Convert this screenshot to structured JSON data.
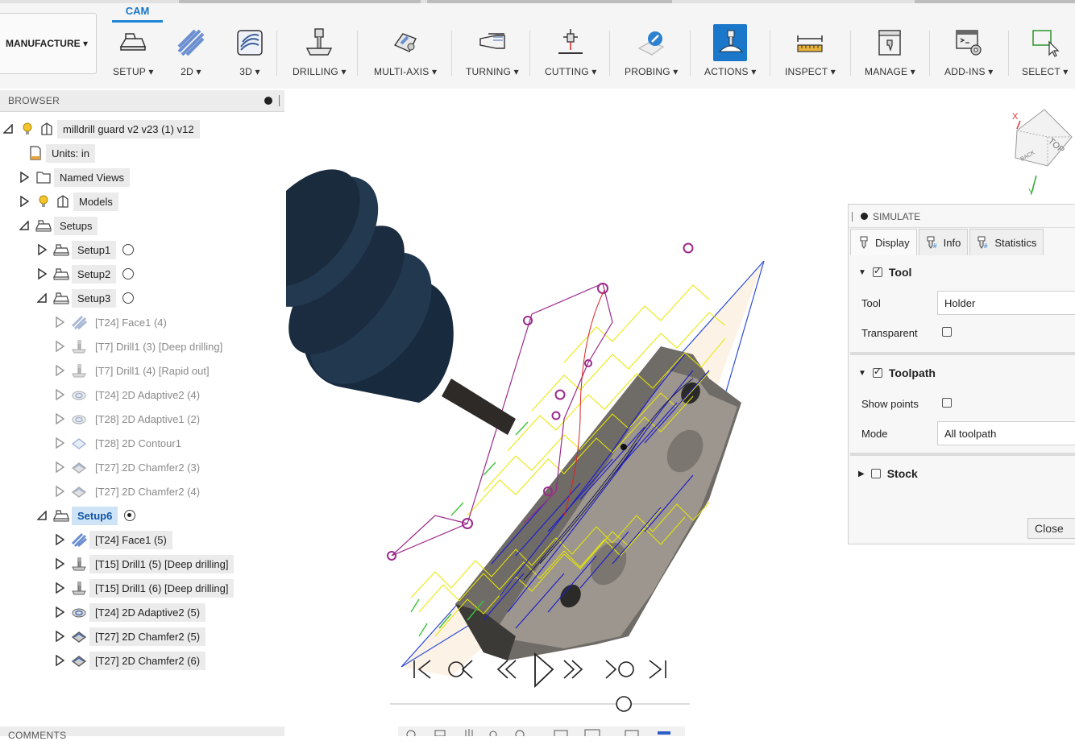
{
  "workspace": {
    "label": "MANUFACTURE ▾"
  },
  "cam_tab": {
    "label": "CAM"
  },
  "toolbar": {
    "groups": [
      {
        "label": "SETUP ▾",
        "icon": "setup-icon"
      },
      {
        "label": "2D ▾",
        "icon": "2d-milling-icon"
      },
      {
        "label": "3D ▾",
        "icon": "3d-milling-icon"
      },
      {
        "label": "DRILLING ▾",
        "icon": "drilling-icon"
      },
      {
        "label": "MULTI-AXIS ▾",
        "icon": "multi-axis-icon"
      },
      {
        "label": "TURNING ▾",
        "icon": "turning-icon"
      },
      {
        "label": "CUTTING ▾",
        "icon": "cutting-icon"
      },
      {
        "label": "PROBING ▾",
        "icon": "probing-icon"
      },
      {
        "label": "ACTIONS ▾",
        "icon": "simulate-icon"
      },
      {
        "label": "INSPECT ▾",
        "icon": "measure-icon"
      },
      {
        "label": "MANAGE ▾",
        "icon": "tool-library-icon"
      },
      {
        "label": "ADD-INS ▾",
        "icon": "scripts-icon"
      },
      {
        "label": "SELECT ▾",
        "icon": "select-icon"
      }
    ]
  },
  "browser": {
    "title": "BROWSER",
    "items": [
      {
        "label": "milldrill guard v2 v23 (1) v12"
      },
      {
        "label": "Units: in"
      },
      {
        "label": "Named Views"
      },
      {
        "label": "Models"
      },
      {
        "label": "Setups"
      },
      {
        "label": "Setup1"
      },
      {
        "label": "Setup2"
      },
      {
        "label": "Setup3"
      },
      {
        "label": "[T24] Face1 (4)"
      },
      {
        "label": "[T7] Drill1 (3) [Deep drilling]"
      },
      {
        "label": "[T7] Drill1 (4) [Rapid out]"
      },
      {
        "label": "[T24] 2D Adaptive2 (4)"
      },
      {
        "label": "[T28] 2D Adaptive1 (2)"
      },
      {
        "label": "[T28] 2D Contour1"
      },
      {
        "label": "[T27] 2D Chamfer2 (3)"
      },
      {
        "label": "[T27] 2D Chamfer2 (4)"
      },
      {
        "label": "Setup6"
      },
      {
        "label": "[T24] Face1 (5)"
      },
      {
        "label": "[T15] Drill1 (5) [Deep drilling]"
      },
      {
        "label": "[T15] Drill1 (6) [Deep drilling]"
      },
      {
        "label": "[T24] 2D Adaptive2 (5)"
      },
      {
        "label": "[T27] 2D Chamfer2 (5)"
      },
      {
        "label": "[T27] 2D Chamfer2 (6)"
      }
    ]
  },
  "comments": {
    "title": "COMMENTS"
  },
  "viewcube": {
    "top": "TOP",
    "back": "BACK",
    "x": "X",
    "y": "Y"
  },
  "simulate": {
    "title": "SIMULATE",
    "tabs": [
      {
        "label": "Display"
      },
      {
        "label": "Info"
      },
      {
        "label": "Statistics"
      }
    ],
    "tool_section": "Tool",
    "tool_label": "Tool",
    "tool_value": "Holder",
    "transparent_label": "Transparent",
    "toolpath_section": "Toolpath",
    "show_points_label": "Show points",
    "mode_label": "Mode",
    "mode_value": "All toolpath",
    "stock_section": "Stock",
    "close_label": "Close"
  },
  "playback": {
    "progress": 0.78
  },
  "colors": {
    "accent": "#1a77c9",
    "tool": "#1f2f44",
    "toolpath_yellow": "#e8e800",
    "toolpath_blue": "#2020c8",
    "rapid_purple": "#9c2a8c"
  }
}
